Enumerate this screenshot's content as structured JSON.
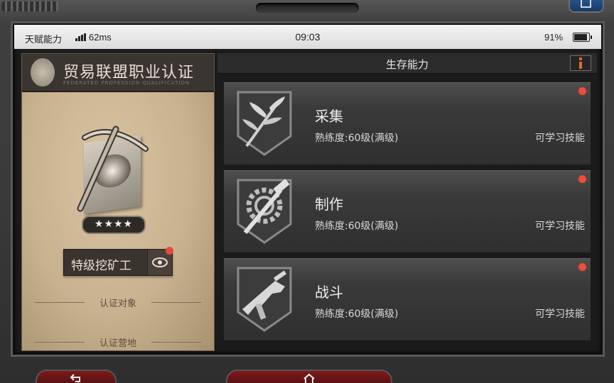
{
  "statusbar": {
    "carrier": "天赋能力",
    "ping": "62ms",
    "time": "09:03",
    "battery_pct": "91%",
    "battery_level": 0.91
  },
  "cert": {
    "title": "贸易联盟职业认证",
    "subtitle": "FEDERATED PROFESSION QUALIFICATION",
    "stars": "★★★★",
    "rank": "特级挖矿工",
    "row1": "认证对象",
    "row2": "认证营地"
  },
  "skills_header": {
    "title": "生存能力"
  },
  "skills": [
    {
      "name": "采集",
      "level": "熟练度:60级(满级)",
      "action": "可学习技能",
      "icon": "gathering-leaves-icon"
    },
    {
      "name": "制作",
      "level": "熟练度:60级(满级)",
      "action": "可学习技能",
      "icon": "crafting-gear-hammer-icon"
    },
    {
      "name": "战斗",
      "level": "熟练度:60级(满级)",
      "action": "可学习技能",
      "icon": "combat-smg-icon"
    }
  ],
  "bottom_nav": {
    "icons": [
      "back-icon",
      "home-icon"
    ]
  },
  "colors": {
    "notify_dot": "#f24a34",
    "parchment": "#c9b290",
    "card_bg": "#3a3a3a"
  }
}
